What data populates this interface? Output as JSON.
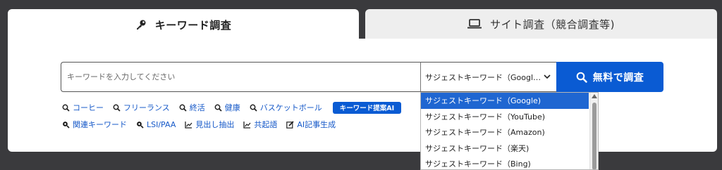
{
  "tabs": [
    {
      "label": "キーワード調査",
      "icon": "key-icon",
      "active": true
    },
    {
      "label": "サイト調査（競合調査等)",
      "icon": "laptop-icon",
      "active": false
    }
  ],
  "search": {
    "placeholder": "キーワードを入力してください",
    "value": ""
  },
  "source_select": {
    "selected": "サジェストキーワード（Googl…",
    "options": [
      "サジェストキーワード（Google)",
      "サジェストキーワード（YouTube)",
      "サジェストキーワード（Amazon)",
      "サジェストキーワード（楽天)",
      "サジェストキーワード（Bing)"
    ]
  },
  "submit": {
    "label": "無料で調査",
    "icon": "search-icon"
  },
  "quick_links_row1": [
    {
      "label": "コーヒー",
      "icon": "search-icon"
    },
    {
      "label": "フリーランス",
      "icon": "search-icon"
    },
    {
      "label": "終活",
      "icon": "search-icon"
    },
    {
      "label": "健康",
      "icon": "search-icon"
    },
    {
      "label": "バスケットボール",
      "icon": "search-icon"
    }
  ],
  "ai_badge": {
    "label": "キーワード提案AI"
  },
  "quick_links_row2": [
    {
      "label": "関連キーワード",
      "icon": "search-plus-icon"
    },
    {
      "label": "LSI/PAA",
      "icon": "search-plus-icon"
    },
    {
      "label": "見出し抽出",
      "icon": "chart-line-icon"
    },
    {
      "label": "共起語",
      "icon": "chart-line-icon"
    },
    {
      "label": "AI記事生成",
      "icon": "edit-icon"
    }
  ],
  "colors": {
    "background": "#3a3a3d",
    "accent": "#0a5bd3",
    "link": "#1558c8",
    "selected_option": "#1f66d1",
    "inactive_tab": "#eeeeee"
  }
}
